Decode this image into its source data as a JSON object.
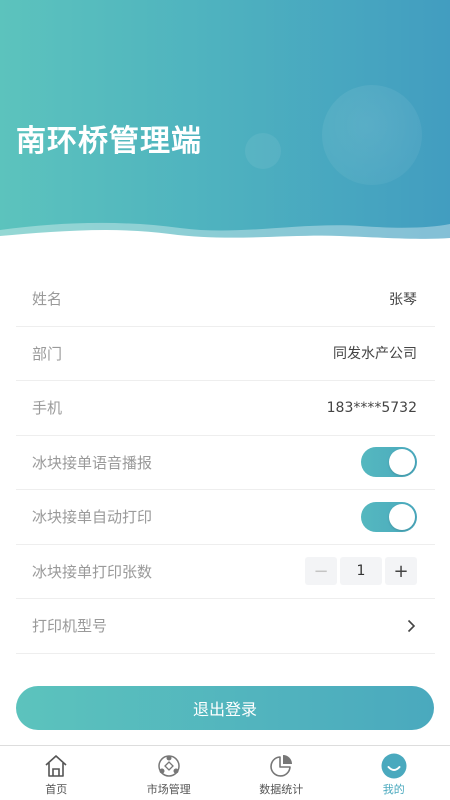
{
  "header": {
    "title": "南环桥管理端"
  },
  "profile": {
    "rows": [
      {
        "label": "姓名",
        "value": "张琴"
      },
      {
        "label": "部门",
        "value": "同发水产公司"
      },
      {
        "label": "手机",
        "value": "183****5732"
      }
    ],
    "voice_broadcast": {
      "label": "冰块接单语音播报",
      "enabled": true
    },
    "auto_print": {
      "label": "冰块接单自动打印",
      "enabled": true
    },
    "print_copies": {
      "label": "冰块接单打印张数",
      "value": "1",
      "minus": "−",
      "plus": "+"
    },
    "printer_model": {
      "label": "打印机型号"
    }
  },
  "logout": {
    "label": "退出登录"
  },
  "tabbar": {
    "items": [
      {
        "label": "首页",
        "icon": "home-icon"
      },
      {
        "label": "市场管理",
        "icon": "market-icon"
      },
      {
        "label": "数据统计",
        "icon": "pie-chart-icon"
      },
      {
        "label": "我的",
        "icon": "profile-icon",
        "active": true
      }
    ]
  },
  "colors": {
    "accent": "#4aa9be",
    "accent_start": "#5cc3bd",
    "accent_end": "#429dc0"
  }
}
